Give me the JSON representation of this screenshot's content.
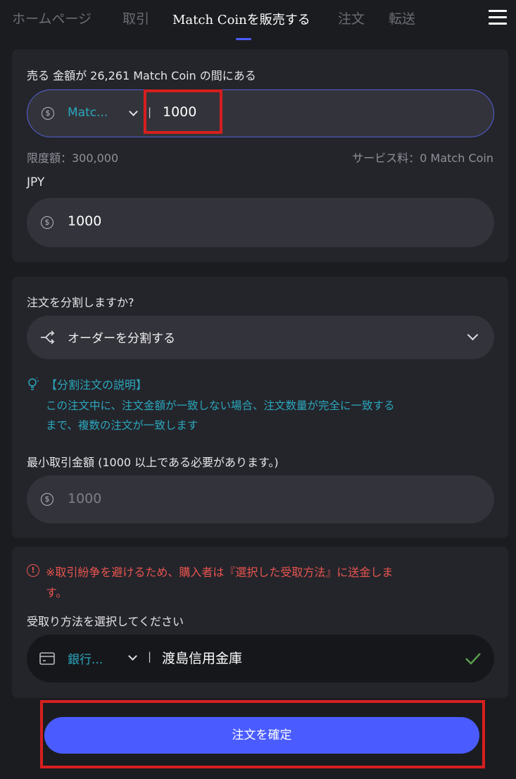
{
  "nav": {
    "tabs": [
      "ホームページ",
      "取引",
      "Match Coinを販売する",
      "注文",
      "転送"
    ],
    "active_index": 2
  },
  "sell": {
    "label": "売る 金額が 26,261 Match Coin の間にある",
    "currency_select": "Matc...",
    "separator": "|",
    "amount_value": "1000",
    "limit_text": "限度額：300,000",
    "fee_text": "サービス料：0 Match Coin",
    "jpy_label": "JPY",
    "jpy_value": "1000"
  },
  "split": {
    "question": "注文を分割しますか?",
    "select_label": "オーダーを分割する",
    "explain_title": "【分割注文の説明】",
    "explain_line1": "この注文中に、注文金額が一致しない場合、注文数量が完全に一致する",
    "explain_line2": "まで、複数の注文が一致します",
    "min_label": "最小取引金額 (1000 以上である必要があります。)",
    "min_placeholder": "1000"
  },
  "payment": {
    "warning_line1": "※取引紛争を避けるため、購入者は『選択した受取方法』に送金しま",
    "warning_line2": "す。",
    "method_label": "受取り方法を選択してください",
    "method_select": "銀行...",
    "separator": "|",
    "bank_name": "渡島信用金庫"
  },
  "confirm": {
    "button_label": "注文を確定"
  },
  "colors": {
    "background": "#1b1c20",
    "card": "#24252b",
    "field": "#33343b",
    "accent": "#4a5cff",
    "teal": "#2aa7bd",
    "warning": "#e8544f",
    "highlight_box": "#d61f1f",
    "check": "#5aa04f"
  },
  "icons": [
    "menu-icon",
    "coin-icon",
    "chevron-down-icon",
    "split-icon",
    "lightbulb-icon",
    "info-icon",
    "bank-card-icon",
    "check-icon"
  ]
}
